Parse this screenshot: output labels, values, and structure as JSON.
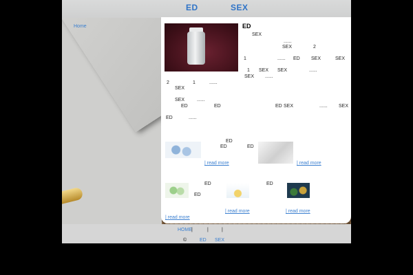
{
  "header": {
    "title_left": "ED",
    "title_right": "SEX"
  },
  "nav": {
    "home": "Home"
  },
  "main": {
    "heading": "ED",
    "lines": [
      {
        "id": "l1",
        "segments": [
          "SEX"
        ]
      },
      {
        "id": "l2",
        "segments": [
          "......"
        ]
      },
      {
        "id": "l3",
        "segments": [
          "SEX",
          "2"
        ]
      },
      {
        "id": "l4",
        "segments": [
          "1",
          "......",
          "ED",
          "SEX",
          "SEX"
        ]
      },
      {
        "id": "l5",
        "segments": [
          "1",
          "SEX",
          "SEX",
          "......"
        ]
      },
      {
        "id": "l6",
        "segments": [
          "SEX",
          "......"
        ]
      },
      {
        "id": "l7",
        "segments": [
          "2",
          "1",
          "......"
        ]
      },
      {
        "id": "l8",
        "segments": [
          "SEX"
        ]
      },
      {
        "id": "l9",
        "segments": [
          "SEX",
          "......"
        ]
      },
      {
        "id": "l10",
        "segments": [
          "ED",
          "ED",
          "ED",
          "SEX",
          "......",
          "SEX"
        ]
      },
      {
        "id": "l11",
        "segments": [
          "ED",
          "......"
        ]
      }
    ]
  },
  "products": {
    "row1": {
      "item_a_labels": [
        "ED",
        "ED",
        "ED"
      ],
      "item_a_link": "| read more",
      "item_b_link": "| read more"
    },
    "row2": {
      "item_a_labels": [
        "ED",
        "ED"
      ],
      "item_b_label": "ED",
      "item_b_link": "| read more",
      "item_c_link": "| read more",
      "item_a_link": "| read more"
    }
  },
  "footer": {
    "nav_home": "HOME",
    "sep1": "|",
    "sep2": "|",
    "sep3": "|",
    "copyright": "©",
    "brand_left": "ED",
    "brand_right": "SEX"
  },
  "colors": {
    "accent": "#3a7fd0",
    "title": "#2e73c7",
    "header_bg": "#d3d4d4",
    "footer_bg": "#d6d6d6"
  }
}
